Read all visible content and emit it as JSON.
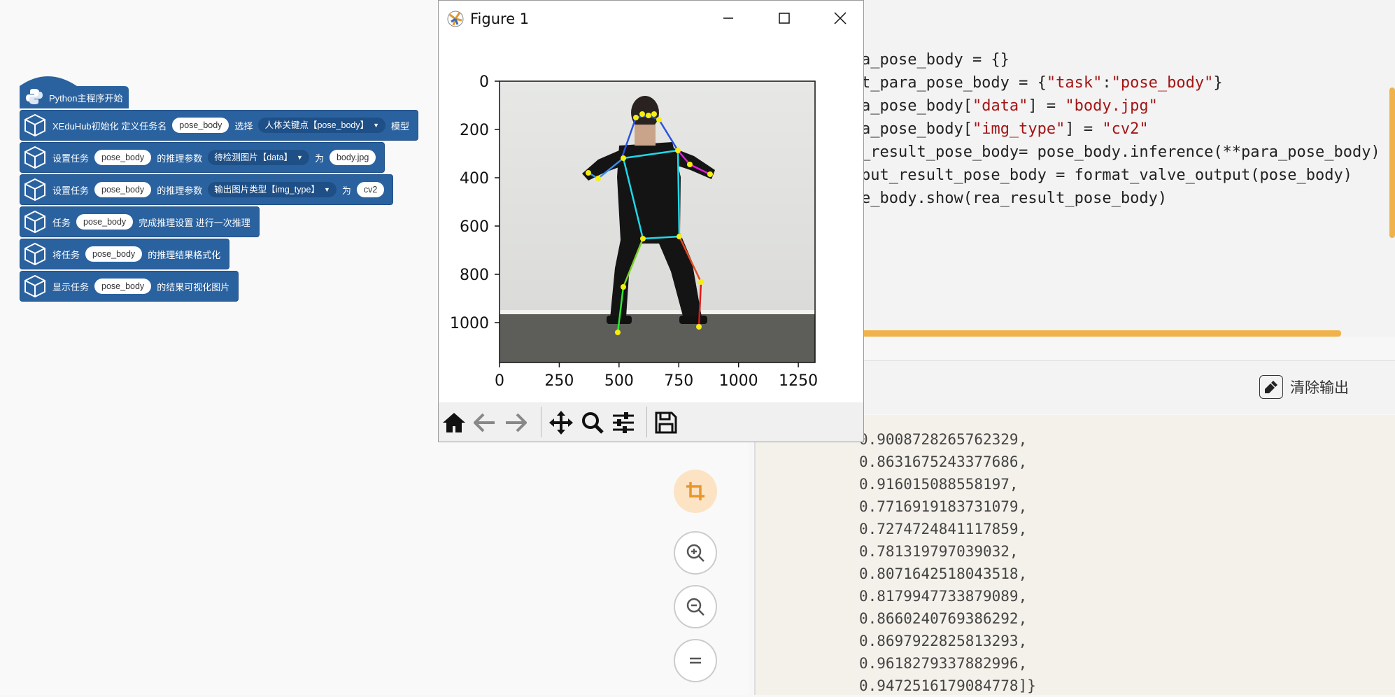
{
  "blocks": {
    "hat_label": "Python主程序开始",
    "rows": [
      {
        "parts": [
          {
            "k": "t",
            "v": "XEduHub初始化 定义任务名"
          },
          {
            "k": "p",
            "v": "pose_body"
          },
          {
            "k": "t",
            "v": "选择"
          },
          {
            "k": "d",
            "v": "人体关键点【pose_body】"
          },
          {
            "k": "t",
            "v": "模型"
          }
        ]
      },
      {
        "parts": [
          {
            "k": "t",
            "v": "设置任务"
          },
          {
            "k": "p",
            "v": "pose_body"
          },
          {
            "k": "t",
            "v": "的推理参数"
          },
          {
            "k": "d",
            "v": "待检测图片【data】"
          },
          {
            "k": "t",
            "v": "为"
          },
          {
            "k": "p",
            "v": "body.jpg"
          }
        ]
      },
      {
        "parts": [
          {
            "k": "t",
            "v": "设置任务"
          },
          {
            "k": "p",
            "v": "pose_body"
          },
          {
            "k": "t",
            "v": "的推理参数"
          },
          {
            "k": "d",
            "v": "输出图片类型【img_type】"
          },
          {
            "k": "t",
            "v": "为"
          },
          {
            "k": "p",
            "v": "cv2"
          }
        ]
      },
      {
        "parts": [
          {
            "k": "t",
            "v": "任务"
          },
          {
            "k": "p",
            "v": "pose_body"
          },
          {
            "k": "t",
            "v": "完成推理设置 进行一次推理"
          }
        ]
      },
      {
        "parts": [
          {
            "k": "t",
            "v": "将任务"
          },
          {
            "k": "p",
            "v": "pose_body"
          },
          {
            "k": "t",
            "v": "的推理结果格式化"
          }
        ]
      },
      {
        "parts": [
          {
            "k": "t",
            "v": "显示任务"
          },
          {
            "k": "p",
            "v": "pose_body"
          },
          {
            "k": "t",
            "v": "的结果可视化图片"
          }
        ]
      }
    ]
  },
  "code": {
    "lines": [
      [
        {
          "t": "a_pose_body = {}"
        }
      ],
      [
        {
          "t": "t_para_pose_body = {"
        },
        {
          "s": "\"task\""
        },
        {
          "t": ":"
        },
        {
          "s": "\"pose_body\""
        },
        {
          "t": "}"
        }
      ],
      [
        {
          "t": "a_pose_body["
        },
        {
          "s": "\"data\""
        },
        {
          "t": "] = "
        },
        {
          "s": "\"body.jpg\""
        }
      ],
      [
        {
          "t": "a_pose_body["
        },
        {
          "s": "\"img_type\""
        },
        {
          "t": "] = "
        },
        {
          "s": "\"cv2\""
        }
      ],
      [
        {
          "t": "_result_pose_body= pose_body.inference(**para_pose_body)"
        }
      ],
      [
        {
          "t": "put_result_pose_body = format_valve_output(pose_body)"
        }
      ],
      [
        {
          "t": "e_body.show(rea_result_pose_body)"
        }
      ]
    ]
  },
  "output": {
    "clear_label": "清除输出",
    "lines": [
      "0.9008728265762329,",
      "0.8631675243377686,",
      "0.916015088558197,",
      "0.7716919183731079,",
      "0.7274724841117859,",
      "0.781319797039032,",
      "0.8071642518043518,",
      "0.8179947733879089,",
      "0.8660240769386292,",
      "0.8697922825813293,",
      "0.9618279337882996,",
      "0.9472516179084778]}"
    ]
  },
  "figure": {
    "title": "Figure 1",
    "x_ticks": [
      "0",
      "250",
      "500",
      "750",
      "1000",
      "1250"
    ],
    "y_ticks": [
      "0",
      "200",
      "400",
      "600",
      "800",
      "1000"
    ]
  },
  "tools": [
    "crop-icon",
    "zoom-in-icon",
    "zoom-out-icon",
    "fit-icon"
  ],
  "colors": {
    "block": "#2a629f",
    "accent": "#f0b24a",
    "tool_active": "#fbe3c4"
  }
}
